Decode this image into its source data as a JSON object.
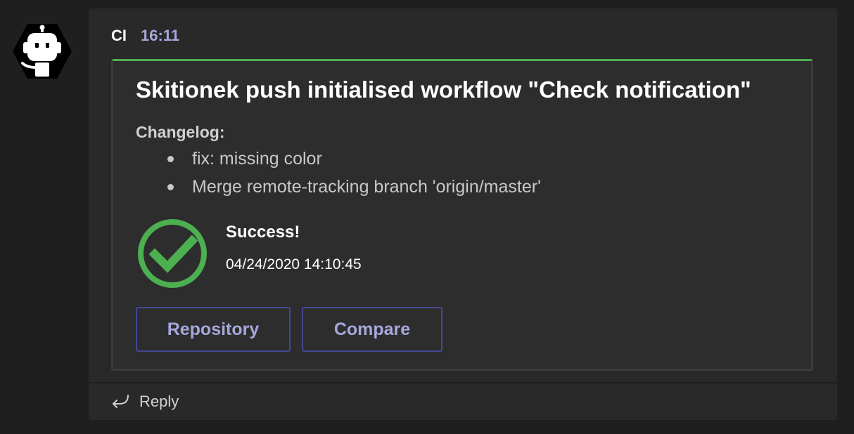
{
  "message": {
    "sender": "CI",
    "time": "16:11",
    "avatar_icon": "robot-icon"
  },
  "card": {
    "accent_color": "#4caf50",
    "title": "Skitionek push initialised workflow \"Check notification\"",
    "changelog_label": "Changelog:",
    "changelog_items": [
      "fix: missing color",
      "Merge remote-tracking branch 'origin/master'"
    ],
    "status": {
      "icon": "check-circle-icon",
      "title": "Success!",
      "date": "04/24/2020 14:10:45"
    },
    "actions": {
      "repository_label": "Repository",
      "compare_label": "Compare"
    }
  },
  "reply": {
    "icon": "reply-arrow-icon",
    "label": "Reply"
  }
}
